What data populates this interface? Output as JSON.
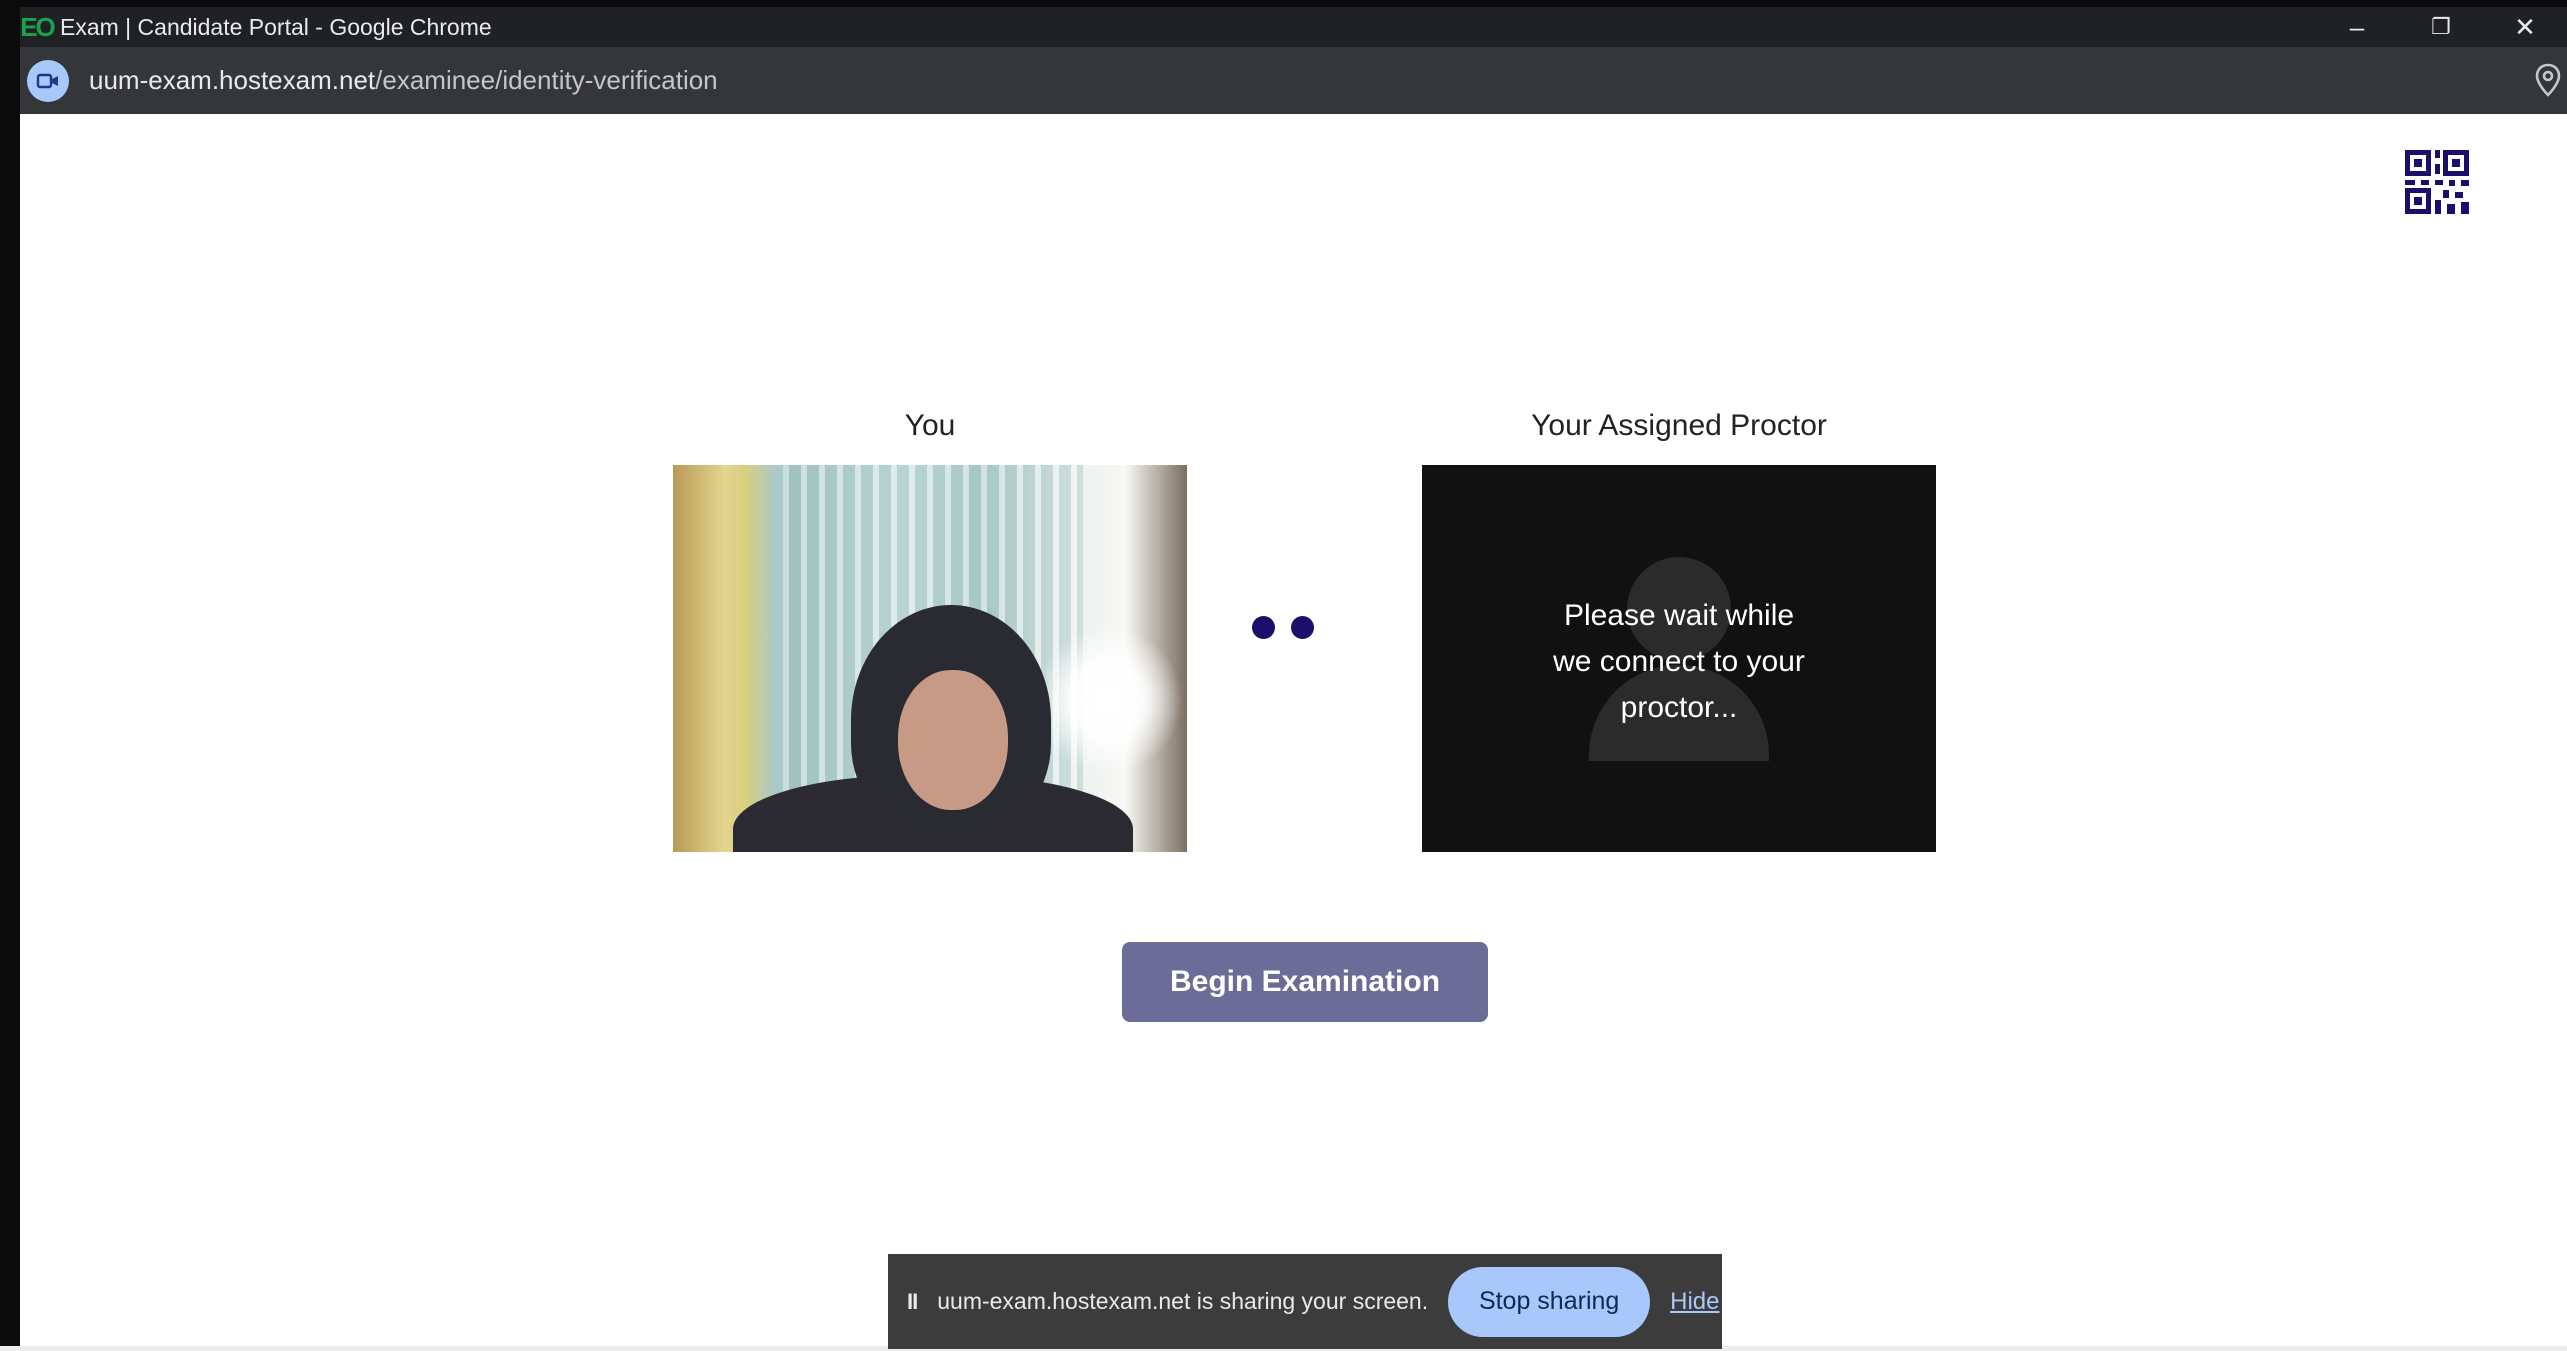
{
  "window": {
    "logo_text": "EO",
    "title": "Exam | Candidate Portal - Google Chrome",
    "controls": {
      "minimize": "–",
      "restore": "❐",
      "close": "✕"
    }
  },
  "address_bar": {
    "site_icon": "video-camera-icon",
    "url_host": "uum-exam.hostexam.net",
    "url_path": "/examinee/identity-verification",
    "right_icon": "location-pin-icon"
  },
  "page": {
    "qr_icon": "qr-code-icon",
    "you_label": "You",
    "proctor_label": "Your Assigned Proctor",
    "proctor_status_lines": [
      "Please wait while",
      "we connect to your",
      "proctor..."
    ],
    "begin_button_label": "Begin Examination",
    "colors": {
      "button_bg": "#6b6d98",
      "dots": "#1a0f6b",
      "proctor_bg": "#111111"
    }
  },
  "sharing_bar": {
    "pause_icon": "II",
    "message": "uum-exam.hostexam.net is sharing your screen.",
    "stop_label": "Stop sharing",
    "hide_label": "Hide",
    "colors": {
      "bar_bg": "#3c3c3c",
      "stop_bg": "#a8c7fa"
    }
  }
}
